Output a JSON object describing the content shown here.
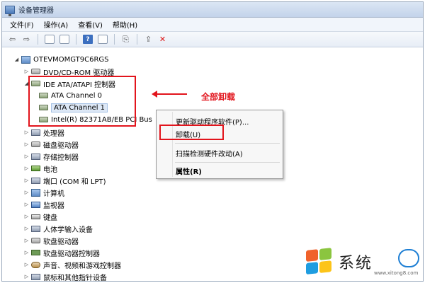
{
  "window": {
    "title": "设备管理器"
  },
  "menu": [
    {
      "label": "文件(F)"
    },
    {
      "label": "操作(A)"
    },
    {
      "label": "查看(V)"
    },
    {
      "label": "帮助(H)"
    }
  ],
  "toolbar": {
    "help_glyph": "?"
  },
  "tree": {
    "root": "OTEVMOMGT9C6RGS",
    "items": [
      {
        "label": "DVD/CD-ROM 驱动器",
        "icon": "disk-icon"
      },
      {
        "label": "IDE ATA/ATAPI 控制器",
        "icon": "ata-icon",
        "expanded": true
      },
      {
        "label": "ATA Channel 0",
        "icon": "ata-icon"
      },
      {
        "label": "ATA Channel 1",
        "icon": "ata-icon"
      },
      {
        "label": "Intel(R) 82371AB/EB PCI Bus",
        "icon": "ata-icon"
      },
      {
        "label": "处理器",
        "icon": "cpu-icon"
      },
      {
        "label": "磁盘驱动器",
        "icon": "disk-icon"
      },
      {
        "label": "存储控制器",
        "icon": "storage-icon"
      },
      {
        "label": "电池",
        "icon": "battery-icon"
      },
      {
        "label": "端口 (COM 和 LPT)",
        "icon": "port-icon"
      },
      {
        "label": "计算机",
        "icon": "computer-icon"
      },
      {
        "label": "监视器",
        "icon": "monitor-icon"
      },
      {
        "label": "键盘",
        "icon": "keyboard-icon"
      },
      {
        "label": "人体学输入设备",
        "icon": "hid-icon"
      },
      {
        "label": "软盘驱动器",
        "icon": "floppy-icon"
      },
      {
        "label": "软盘驱动器控制器",
        "icon": "floppy-controller-icon"
      },
      {
        "label": "声音、视频和游戏控制器",
        "icon": "sound-icon"
      },
      {
        "label": "鼠标和其他指针设备",
        "icon": "mouse-icon"
      }
    ]
  },
  "annotation": {
    "text": "全部卸载"
  },
  "context_menu": {
    "update_driver": "更新驱动程序软件(P)...",
    "uninstall": "卸载(U)",
    "scan": "扫描检测硬件改动(A)",
    "properties": "属性(R)"
  },
  "watermark": {
    "text": "系统",
    "url": "www.xitong8.com"
  },
  "colors": {
    "annotation_red": "#e2141c",
    "selection": "#dde8f6"
  }
}
